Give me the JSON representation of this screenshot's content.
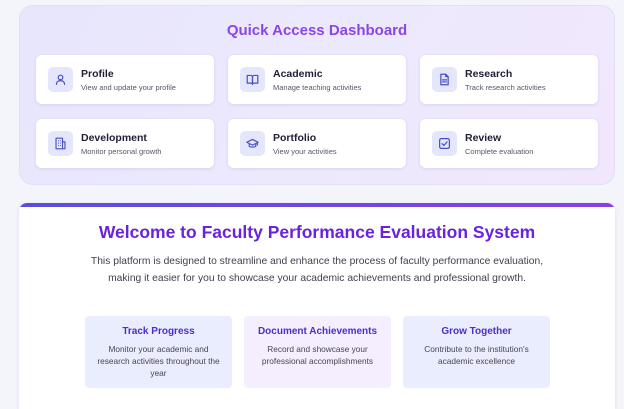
{
  "quick_access": {
    "title": "Quick Access Dashboard",
    "cards": [
      {
        "title": "Profile",
        "subtitle": "View and update your profile",
        "icon": "user-icon"
      },
      {
        "title": "Academic",
        "subtitle": "Manage teaching activities",
        "icon": "book-icon"
      },
      {
        "title": "Research",
        "subtitle": "Track research activities",
        "icon": "document-icon"
      },
      {
        "title": "Development",
        "subtitle": "Monitor personal growth",
        "icon": "building-icon"
      },
      {
        "title": "Portfolio",
        "subtitle": "View your activities",
        "icon": "graduation-cap-icon"
      },
      {
        "title": "Review",
        "subtitle": "Complete evaluation",
        "icon": "checkbox-icon"
      }
    ]
  },
  "welcome": {
    "title": "Welcome to Faculty Performance Evaluation System",
    "description": "This platform is designed to streamline and enhance the process of faculty performance evaluation, making it easier for you to showcase your academic achievements and professional growth.",
    "features": [
      {
        "title": "Track Progress",
        "description": "Monitor your academic and research activities throughout the year"
      },
      {
        "title": "Document Achievements",
        "description": "Record and showcase your professional accomplishments"
      },
      {
        "title": "Grow Together",
        "description": "Contribute to the institution's academic excellence"
      }
    ]
  },
  "colors": {
    "accent": "#8b46e6",
    "title_purple": "#6a23dd",
    "feature_title": "#4b2fc6",
    "icon_bg": "#e4e6fb",
    "icon_stroke": "#4a4fc4"
  }
}
